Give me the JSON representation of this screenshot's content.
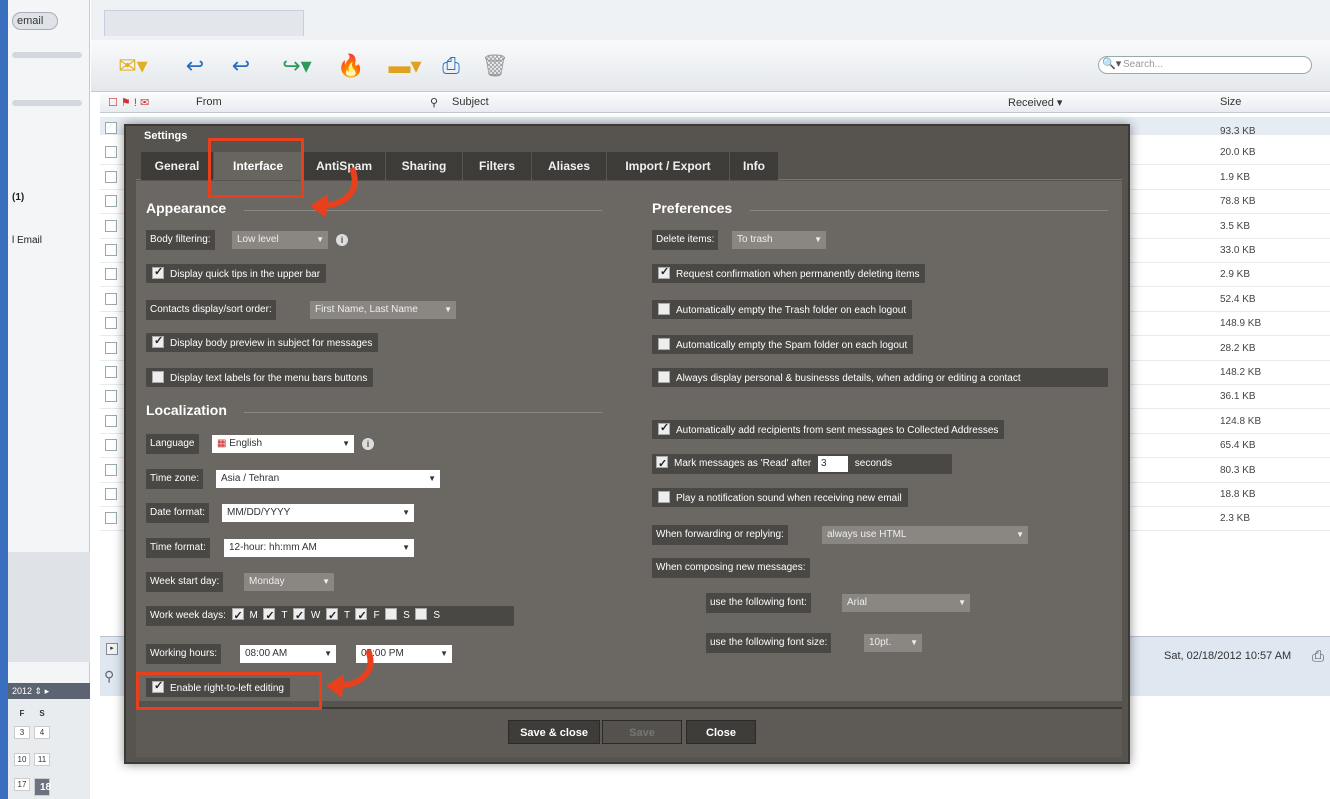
{
  "left": {
    "email_button": "email",
    "label_count": "(1)",
    "label_email": "l Email"
  },
  "search": {
    "placeholder": "Search..."
  },
  "grid": {
    "headers": {
      "from": "From",
      "subject": "Subject",
      "received": "Received ▾",
      "size": "Size"
    },
    "sizes": [
      "93.3 KB",
      "20.0 KB",
      "1.9 KB",
      "78.8 KB",
      "3.5 KB",
      "33.0 KB",
      "2.9 KB",
      "52.4 KB",
      "148.9 KB",
      "28.2 KB",
      "148.2 KB",
      "36.1 KB",
      "124.8 KB",
      "65.4 KB",
      "80.3 KB",
      "18.8 KB",
      "2.3 KB"
    ]
  },
  "preview": {
    "date": "Sat, 02/18/2012 10:57 AM"
  },
  "calendar": {
    "header": "2012",
    "days": [
      "F",
      "S",
      "3",
      "4",
      "10",
      "11",
      "17",
      "18"
    ]
  },
  "settings": {
    "title": "Settings",
    "tabs": [
      "General",
      "Interface",
      "AntiSpam",
      "Sharing",
      "Filters",
      "Aliases",
      "Import / Export",
      "Info"
    ],
    "appearance": {
      "heading": "Appearance",
      "body_filtering_label": "Body filtering:",
      "body_filtering_value": "Low level",
      "quick_tips": "Display quick tips in the upper bar",
      "contacts_label": "Contacts display/sort order:",
      "contacts_value": "First Name, Last Name",
      "body_preview": "Display body preview in subject for messages",
      "text_labels": "Display text labels for the menu bars buttons"
    },
    "localization": {
      "heading": "Localization",
      "language_label": "Language",
      "language_value": "English",
      "timezone_label": "Time zone:",
      "timezone_value": "Asia / Tehran",
      "dateformat_label": "Date format:",
      "dateformat_value": "MM/DD/YYYY",
      "timeformat_label": "Time format:",
      "timeformat_value": "12-hour: hh:mm AM",
      "weekstart_label": "Week start day:",
      "weekstart_value": "Monday",
      "workweek_label": "Work week days:",
      "workdays": [
        "M",
        "T",
        "W",
        "T",
        "F",
        "S",
        "S"
      ],
      "workhours_label": "Working hours:",
      "workhours_start": "08:00 AM",
      "workhours_end": "05:00 PM",
      "rtl": "Enable right-to-left editing"
    },
    "preferences": {
      "heading": "Preferences",
      "delete_label": "Delete items:",
      "delete_value": "To trash",
      "confirm_delete": "Request confirmation when permanently deleting items",
      "empty_trash": "Automatically empty the Trash folder on each logout",
      "empty_spam": "Automatically empty the Spam folder on each logout",
      "personal_details": "Always display personal & businesss details, when adding or editing a contact",
      "collected": "Automatically add recipients from sent messages to Collected Addresses",
      "mark_read": "Mark messages as 'Read' after",
      "mark_read_value": "3",
      "seconds": "seconds",
      "notification": "Play a notification sound when receiving new email",
      "forwarding_label": "When forwarding or replying:",
      "forwarding_value": "always use HTML",
      "composing_label": "When composing new messages:",
      "font_label": "use the following font:",
      "font_value": "Arial",
      "fontsize_label": "use the following font size:",
      "fontsize_value": "10pt."
    },
    "buttons": {
      "save_close": "Save & close",
      "save": "Save",
      "close": "Close"
    }
  },
  "colors": {
    "highlight": "#e8401c",
    "dialog": "#575450"
  }
}
